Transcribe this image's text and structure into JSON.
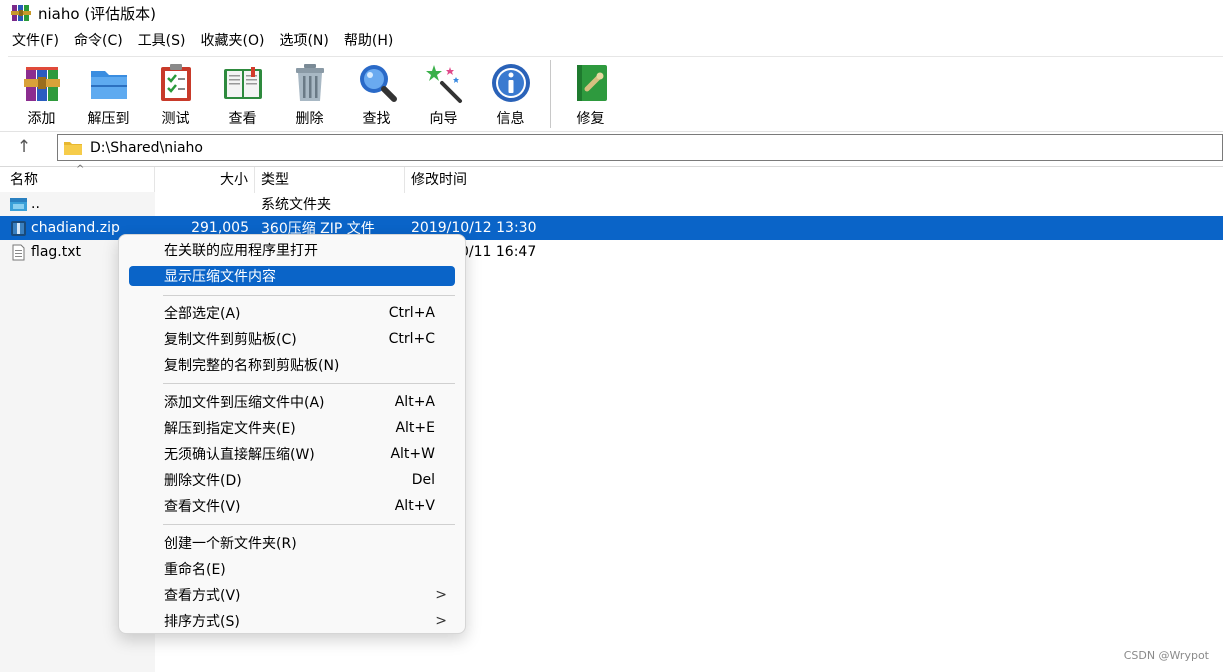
{
  "window": {
    "title": "niaho (评估版本)"
  },
  "menubar": [
    "文件(F)",
    "命令(C)",
    "工具(S)",
    "收藏夹(O)",
    "选项(N)",
    "帮助(H)"
  ],
  "toolbar": {
    "buttons": [
      {
        "label": "添加",
        "icon": "books-add-icon"
      },
      {
        "label": "解压到",
        "icon": "folder-extract-icon"
      },
      {
        "label": "测试",
        "icon": "clipboard-test-icon"
      },
      {
        "label": "查看",
        "icon": "open-book-icon"
      },
      {
        "label": "删除",
        "icon": "trash-can-icon"
      },
      {
        "label": "查找",
        "icon": "magnifier-icon"
      },
      {
        "label": "向导",
        "icon": "magic-wand-icon"
      },
      {
        "label": "信息",
        "icon": "info-icon"
      },
      {
        "label": "修复",
        "icon": "repair-kit-icon"
      }
    ]
  },
  "address": {
    "path": "D:\\Shared\\niaho"
  },
  "columns": {
    "name": "名称",
    "size": "大小",
    "type": "类型",
    "mtime": "修改时间",
    "sort_indicator": "^"
  },
  "files": [
    {
      "name": "..",
      "size": "",
      "type": "系统文件夹",
      "mtime": "",
      "icon": "parent-folder-icon"
    },
    {
      "name": "chadiand.zip",
      "size": "291,005",
      "type": "360压缩 ZIP 文件",
      "mtime": "2019/10/12 13:30",
      "icon": "zip-archive-icon",
      "selected": true
    },
    {
      "name": "flag.txt",
      "size": "",
      "type": "",
      "mtime": "0/11 16:47",
      "icon": "text-file-icon"
    }
  ],
  "context_menu": {
    "groups": [
      [
        {
          "label": "在关联的应用程序里打开",
          "shortcut": ""
        },
        {
          "label": "显示压缩文件内容",
          "shortcut": "",
          "highlighted": true
        }
      ],
      [
        {
          "label": "全部选定(A)",
          "shortcut": "Ctrl+A"
        },
        {
          "label": "复制文件到剪贴板(C)",
          "shortcut": "Ctrl+C"
        },
        {
          "label": "复制完整的名称到剪贴板(N)",
          "shortcut": ""
        }
      ],
      [
        {
          "label": "添加文件到压缩文件中(A)",
          "shortcut": "Alt+A"
        },
        {
          "label": "解压到指定文件夹(E)",
          "shortcut": "Alt+E"
        },
        {
          "label": "无须确认直接解压缩(W)",
          "shortcut": "Alt+W"
        },
        {
          "label": "删除文件(D)",
          "shortcut": "Del"
        },
        {
          "label": "查看文件(V)",
          "shortcut": "Alt+V"
        }
      ],
      [
        {
          "label": "创建一个新文件夹(R)",
          "shortcut": ""
        },
        {
          "label": "重命名(E)",
          "shortcut": ""
        },
        {
          "label": "查看方式(V)",
          "shortcut": "",
          "submenu": ">"
        },
        {
          "label": "排序方式(S)",
          "shortcut": "",
          "submenu": ">"
        }
      ]
    ]
  },
  "watermark": "CSDN @Wrypot",
  "colors": {
    "selection": "#0a64c8",
    "menu_bg": "#f9f9f9"
  }
}
